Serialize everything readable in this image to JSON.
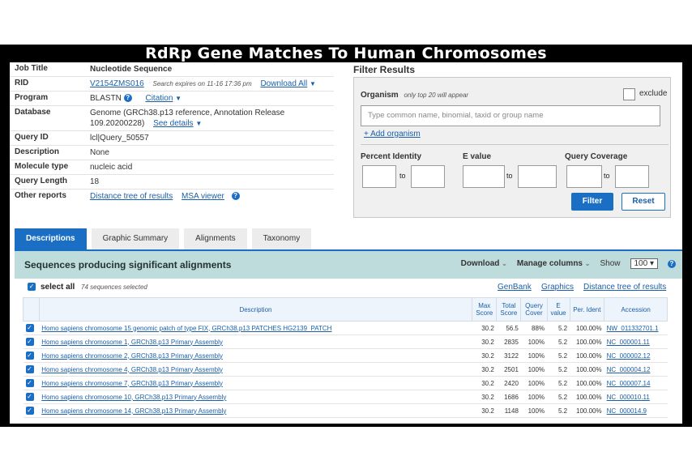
{
  "banner_title": "RdRp Gene Matches To Human Chromosomes",
  "job": {
    "rows": [
      {
        "label": "Job Title",
        "value": "Nucleotide Sequence"
      },
      {
        "label": "RID",
        "value": "V2154ZMS016",
        "extra": "Search expires on 11-16 17:36 pm",
        "link2": "Download All"
      },
      {
        "label": "Program",
        "value": "BLASTN",
        "link2": "Citation"
      },
      {
        "label": "Database",
        "value": "Genome (GRCh38.p13 reference, Annotation Release 109.20200228)",
        "link2": "See details"
      },
      {
        "label": "Query ID",
        "value": "lcl|Query_50557"
      },
      {
        "label": "Description",
        "value": "None"
      },
      {
        "label": "Molecule type",
        "value": "nucleic acid"
      },
      {
        "label": "Query Length",
        "value": "18"
      },
      {
        "label": "Other reports",
        "value": "Distance tree of results",
        "link2": "MSA viewer"
      }
    ]
  },
  "filter": {
    "title": "Filter Results",
    "organism_label": "Organism",
    "organism_note": "only top 20 will appear",
    "exclude_label": "exclude",
    "organism_placeholder": "Type common name, binomial, taxid or group name",
    "add_organism": "+ Add organism",
    "percent_identity": "Percent Identity",
    "evalue": "E value",
    "query_coverage": "Query Coverage",
    "to": "to",
    "filter_btn": "Filter",
    "reset_btn": "Reset"
  },
  "tabs": [
    {
      "label": "Descriptions",
      "active": true
    },
    {
      "label": "Graphic Summary"
    },
    {
      "label": "Alignments"
    },
    {
      "label": "Taxonomy"
    }
  ],
  "results": {
    "title": "Sequences producing significant alignments",
    "download": "Download",
    "manage_columns": "Manage columns",
    "show_label": "Show",
    "show_value": "100",
    "select_all": "select all",
    "selected_count": "74 sequences selected",
    "links": [
      "GenBank",
      "Graphics",
      "Distance tree of results"
    ],
    "columns": [
      "Description",
      "Max Score",
      "Total Score",
      "Query Cover",
      "E value",
      "Per. Ident",
      "Accession"
    ],
    "rows": [
      {
        "desc": "Homo sapiens chromosome 15 genomic patch of type FIX, GRCh38.p13 PATCHES HG2139_PATCH",
        "max": "30.2",
        "total": "56.5",
        "cover": "88%",
        "e": "5.2",
        "ident": "100.00%",
        "acc": "NW_011332701.1"
      },
      {
        "desc": "Homo sapiens chromosome 1, GRCh38.p13 Primary Assembly",
        "max": "30.2",
        "total": "2835",
        "cover": "100%",
        "e": "5.2",
        "ident": "100.00%",
        "acc": "NC_000001.11"
      },
      {
        "desc": "Homo sapiens chromosome 2, GRCh38.p13 Primary Assembly",
        "max": "30.2",
        "total": "3122",
        "cover": "100%",
        "e": "5.2",
        "ident": "100.00%",
        "acc": "NC_000002.12"
      },
      {
        "desc": "Homo sapiens chromosome 4, GRCh38.p13 Primary Assembly",
        "max": "30.2",
        "total": "2501",
        "cover": "100%",
        "e": "5.2",
        "ident": "100.00%",
        "acc": "NC_000004.12"
      },
      {
        "desc": "Homo sapiens chromosome 7, GRCh38.p13 Primary Assembly",
        "max": "30.2",
        "total": "2420",
        "cover": "100%",
        "e": "5.2",
        "ident": "100.00%",
        "acc": "NC_000007.14"
      },
      {
        "desc": "Homo sapiens chromosome 10, GRCh38.p13 Primary Assembly",
        "max": "30.2",
        "total": "1686",
        "cover": "100%",
        "e": "5.2",
        "ident": "100.00%",
        "acc": "NC_000010.11"
      },
      {
        "desc": "Homo sapiens chromosome 14, GRCh38.p13 Primary Assembly",
        "max": "30.2",
        "total": "1148",
        "cover": "100%",
        "e": "5.2",
        "ident": "100.00%",
        "acc": "NC_000014.9"
      }
    ]
  },
  "colors": {
    "accent": "#1a6fc4",
    "header_band": "#bfdcdc",
    "frame": "#000000"
  }
}
